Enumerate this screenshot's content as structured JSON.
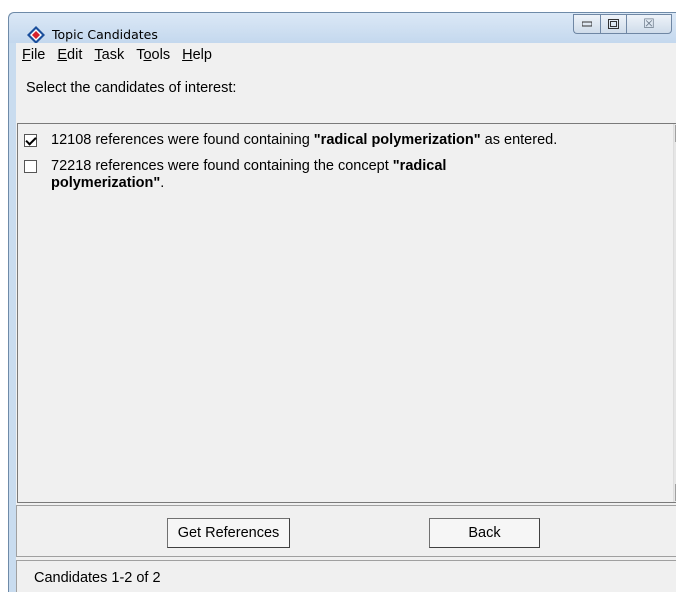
{
  "window": {
    "title": "Topic Candidates",
    "close_glyph": "☒"
  },
  "menu": [
    {
      "label": "File",
      "mnemonic": "F",
      "rest": "ile"
    },
    {
      "label": "Edit",
      "mnemonic": "E",
      "rest": "dit"
    },
    {
      "label": "Task",
      "mnemonic": "T",
      "rest": "ask"
    },
    {
      "label": "Tools",
      "pre": "T",
      "mnemonic": "o",
      "rest": "ols"
    },
    {
      "label": "Help",
      "mnemonic": "H",
      "rest": "elp"
    }
  ],
  "prompt": "Select the candidates of interest:",
  "candidates": [
    {
      "checked": true,
      "prefix": "12108 references were found containing ",
      "term": "\"radical polymerization\"",
      "suffix": " as entered."
    },
    {
      "checked": false,
      "prefix": "72218 references were found containing the concept ",
      "term": "\"radical polymerization\"",
      "suffix": "."
    }
  ],
  "buttons": {
    "get_references": "Get References",
    "back": "Back"
  },
  "status": "Candidates 1-2 of 2",
  "colors": {
    "titlebar": "#c4d8ee",
    "client_bg": "#f0f0f0",
    "icon_primary": "#1b4f9c",
    "icon_accent": "#d9232d"
  }
}
